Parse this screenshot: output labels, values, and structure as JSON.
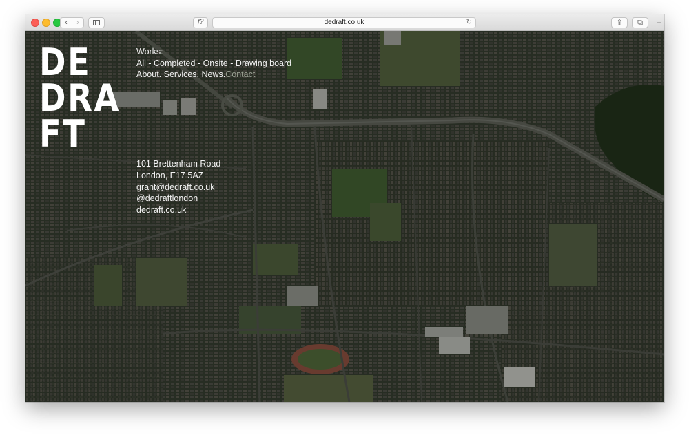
{
  "browser": {
    "url": "dedraft.co.uk",
    "reader_label": "f?",
    "back_glyph": "‹",
    "forward_glyph": "›",
    "reload_glyph": "↻",
    "share_glyph": "⇪",
    "tabs_glyph": "⧉",
    "new_tab_glyph": "+"
  },
  "logo": {
    "line1": "DE",
    "line2": "DRA",
    "line3": "FT"
  },
  "nav": {
    "works_label": "Works:",
    "all": "All",
    "completed": "Completed",
    "onsite": "Onsite",
    "drawing_board": "Drawing board",
    "separator": " - ",
    "about": "About.",
    "services": "Services.",
    "news": "News.",
    "contact": "Contact"
  },
  "contact_info": {
    "address_line1": "101 Brettenham Road",
    "address_line2": "London, E17 5AZ",
    "email": "grant@dedraft.co.uk",
    "twitter": "@dedraftlondon",
    "website": "dedraft.co.uk"
  },
  "colors": {
    "crosshair": "#b8b24a",
    "muted_link": "#9aa093"
  }
}
